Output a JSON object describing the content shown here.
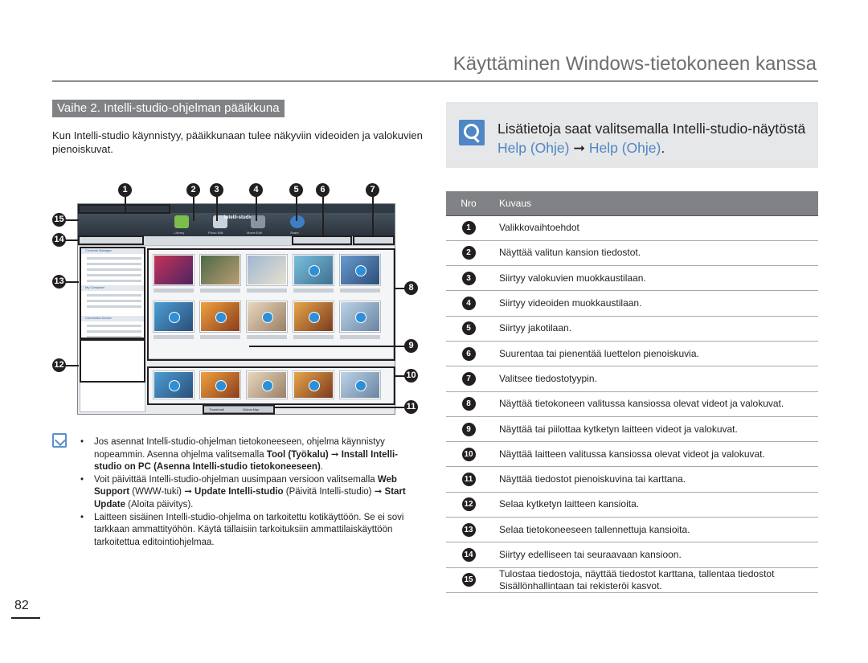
{
  "header": {
    "title": "Käyttäminen Windows-tietokoneen kanssa"
  },
  "section": {
    "title": "Vaihe 2. Intelli-studio-ohjelman pääikkuna"
  },
  "intro": "Kun Intelli-studio käynnistyy, pääikkunaan tulee näkyviin videoiden ja valokuvien pienoiskuvat.",
  "screenshot": {
    "toolbar_labels": [
      "Library",
      "Photo Edit",
      "Movie Edit",
      "Share"
    ],
    "app_logo": "Intelli-studio",
    "sidebar_sections": [
      "Contents Manager",
      "My Computer",
      "Connected Device"
    ],
    "tabs": [
      "Thumbnail",
      "Global Map"
    ]
  },
  "markers": [
    "1",
    "2",
    "3",
    "4",
    "5",
    "6",
    "7",
    "8",
    "9",
    "10",
    "11",
    "12",
    "13",
    "14",
    "15"
  ],
  "notes": {
    "n1_a": "Jos asennat Intelli-studio-ohjelman tietokoneeseen, ohjelma käynnistyy nopeammin. Asenna ohjelma valitsemalla ",
    "n1_b": "Tool (Työkalu)",
    "n1_c": " ➞ ",
    "n1_d": "Install Intelli-studio on PC (Asenna Intelli-studio tietokoneeseen)",
    "n1_e": ".",
    "n2_a": "Voit päivittää Intelli-studio-ohjelman uusimpaan versioon valitsemalla ",
    "n2_b": "Web Support",
    "n2_c": " (WWW-tuki) ➞ ",
    "n2_d": "Update Intelli-studio",
    "n2_e": " (Päivitä Intelli-studio) ➞ ",
    "n2_f": "Start Update",
    "n2_g": " (Aloita päivitys).",
    "n3": "Laitteen sisäinen Intelli-studio-ohjelma on tarkoitettu kotikäyttöön. Se ei sovi tarkkaan ammattityöhön. Käytä tällaisiin tarkoituksiin ammattilaiskäyttöön tarkoitettua editointiohjelmaa."
  },
  "page_number": "82",
  "info": {
    "prefix": "Lisätietoja saat valitsemalla Intelli-studio-näytöstä ",
    "help1": "Help (Ohje)",
    "arrow": " ➞ ",
    "help2": "Help (Ohje)",
    "suffix": "."
  },
  "table": {
    "headers": {
      "nro": "Nro",
      "kuvaus": "Kuvaus"
    },
    "rows": [
      {
        "nro": "1",
        "desc": "Valikkovaihtoehdot"
      },
      {
        "nro": "2",
        "desc": "Näyttää valitun kansion tiedostot."
      },
      {
        "nro": "3",
        "desc": "Siirtyy valokuvien muokkaustilaan."
      },
      {
        "nro": "4",
        "desc": "Siirtyy videoiden muokkaustilaan."
      },
      {
        "nro": "5",
        "desc": "Siirtyy jakotilaan."
      },
      {
        "nro": "6",
        "desc": "Suurentaa tai pienentää luettelon pienoiskuvia."
      },
      {
        "nro": "7",
        "desc": "Valitsee tiedostotyypin."
      },
      {
        "nro": "8",
        "desc": "Näyttää tietokoneen valitussa kansiossa olevat videot ja valokuvat."
      },
      {
        "nro": "9",
        "desc": "Näyttää tai piilottaa kytketyn laitteen videot ja valokuvat."
      },
      {
        "nro": "10",
        "desc": "Näyttää laitteen valitussa kansiossa olevat videot ja valokuvat."
      },
      {
        "nro": "11",
        "desc": "Näyttää tiedostot pienoiskuvina tai karttana."
      },
      {
        "nro": "12",
        "desc": "Selaa kytketyn laitteen kansioita."
      },
      {
        "nro": "13",
        "desc": "Selaa tietokoneeseen tallennettuja kansioita."
      },
      {
        "nro": "14",
        "desc": "Siirtyy edelliseen tai seuraavaan kansioon."
      },
      {
        "nro": "15",
        "desc": "Tulostaa tiedostoja, näyttää tiedostot karttana, tallentaa tiedostot Sisällönhallintaan tai rekisteröi kasvot."
      }
    ]
  },
  "colors": {
    "accent": "#4f86c6",
    "header_gray": "#808285",
    "title_gray": "#6d6e71"
  }
}
